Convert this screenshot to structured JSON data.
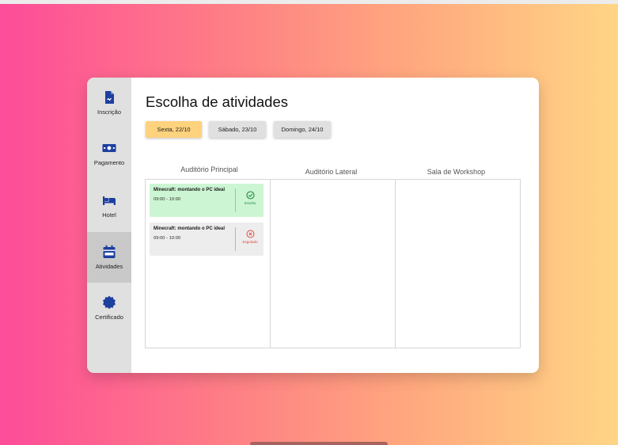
{
  "colors": {
    "accent": "#ffd27e",
    "tab_inactive": "#e0e0e0",
    "success": "#1e8a3c",
    "success_bg": "#ccf5d3",
    "danger": "#e0483f",
    "sidebar": "#e0e0e0",
    "sidebar_active": "#c9c9c9"
  },
  "sidebar": {
    "items": [
      {
        "label": "Inscrição",
        "icon": "document-icon"
      },
      {
        "label": "Pagamento",
        "icon": "payment-icon"
      },
      {
        "label": "Hotel",
        "icon": "bed-icon"
      },
      {
        "label": "Atividades",
        "icon": "calendar-icon",
        "active": true
      },
      {
        "label": "Certificado",
        "icon": "badge-icon"
      }
    ]
  },
  "main": {
    "title": "Escolha de atividades",
    "days": [
      {
        "label": "Sexta, 22/10",
        "selected": true
      },
      {
        "label": "Sábado, 23/10",
        "selected": false
      },
      {
        "label": "Domingo, 24/10",
        "selected": false
      }
    ],
    "rooms": [
      {
        "name": "Auditório Principal",
        "activities": [
          {
            "title": "Minecraft: montando o PC ideal",
            "time": "09:00 - 10:00",
            "status": "Inscrito",
            "state": "enrolled",
            "icon": "check-circle-icon"
          },
          {
            "title": "Minecraft: montando o PC ideal",
            "time": "09:00 - 10:00",
            "status": "Esgotado",
            "state": "sold-out",
            "icon": "x-circle-icon"
          }
        ]
      },
      {
        "name": "Auditório Lateral",
        "activities": []
      },
      {
        "name": "Sala de Workshop",
        "activities": []
      }
    ]
  }
}
